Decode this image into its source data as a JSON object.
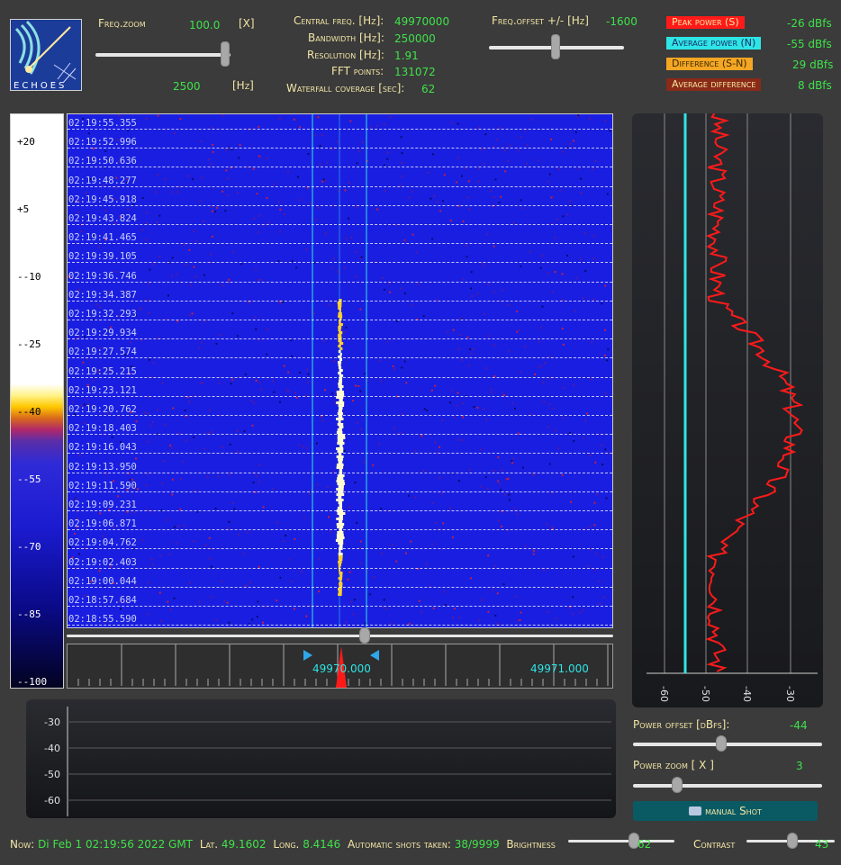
{
  "header": {
    "freq_zoom_label": "Freq.zoom",
    "freq_zoom_value": "100.0",
    "freq_zoom_unit": "[X]",
    "freq_zoom_hz_value": "2500",
    "freq_zoom_hz_unit": "[Hz]",
    "central_freq_label": "Central freq. [Hz]:",
    "central_freq_value": "49970000",
    "bandwidth_label": "Bandwidth [Hz]:",
    "bandwidth_value": "250000",
    "resolution_label": "Resolution [Hz]:",
    "resolution_value": "1.91",
    "fft_points_label": "FFT points:",
    "fft_points_value": "131072",
    "waterfall_coverage_label": "Waterfall coverage [sec]:",
    "waterfall_coverage_value": "62",
    "freq_offset_label": "Freq.offset +/- [Hz]",
    "freq_offset_value": "-1600"
  },
  "legend": [
    {
      "label": "Peak power (S)",
      "value": "-26 dBfs",
      "bg": "#ff1a1a",
      "fg": "#f5e8a0"
    },
    {
      "label": "Average power (N)",
      "value": "-55 dBfs",
      "bg": "#2ee5e5",
      "fg": "#1a2a6a"
    },
    {
      "label": "Difference (S-N)",
      "value": "29 dBfs",
      "bg": "#f5a623",
      "fg": "#3a2a00"
    },
    {
      "label": "Average difference",
      "value": "8 dBfs",
      "bg": "#8a2a18",
      "fg": "#f5e8a0"
    }
  ],
  "colorbar_ticks": [
    "+20",
    "+5",
    "--10",
    "--25",
    "--40",
    "--55",
    "--70",
    "--85",
    "--100"
  ],
  "timestamps": [
    "02:19:55.355",
    "02:19:52.996",
    "02:19:50.636",
    "02:19:48.277",
    "02:19:45.918",
    "02:19:43.824",
    "02:19:41.465",
    "02:19:39.105",
    "02:19:36.746",
    "02:19:34.387",
    "02:19:32.293",
    "02:19:29.934",
    "02:19:27.574",
    "02:19:25.215",
    "02:19:23.121",
    "02:19:20.762",
    "02:19:18.403",
    "02:19:16.043",
    "02:19:13.950",
    "02:19:11.590",
    "02:19:09.231",
    "02:19:06.871",
    "02:19:04.762",
    "02:19:02.403",
    "02:19:00.044",
    "02:18:57.684",
    "02:18:55.590"
  ],
  "scale": {
    "label1": "49970.000",
    "label2": "49971.000"
  },
  "power_axis_ticks": [
    "-60",
    "-50",
    "-40",
    "-30"
  ],
  "lower_plot_ticks": [
    "-30",
    "-40",
    "-50",
    "-60"
  ],
  "power_offset_label": "Power offset [dBfs]:",
  "power_offset_value": "-44",
  "power_zoom_label": "Power zoom [ X ]",
  "power_zoom_value": "3",
  "manual_shot_label": "manual Shot",
  "colors": {
    "accent_green": "#3fe24a",
    "label_yellow": "#f3e6a6",
    "cyan": "#2ee5e5",
    "red": "#ff1a1a"
  },
  "footer": {
    "now_label": "Now:",
    "now_value": "Di Feb 1 02:19:56 2022 GMT",
    "lat_label": "Lat.",
    "lat_value": "49.1602",
    "long_label": "Long.",
    "long_value": "8.4146",
    "shots_label": "Automatic shots taken:",
    "shots_value": "38/9999",
    "brightness_label": "Brightness",
    "brightness_value": "62",
    "contrast_label": "Contrast",
    "contrast_value": "43"
  }
}
